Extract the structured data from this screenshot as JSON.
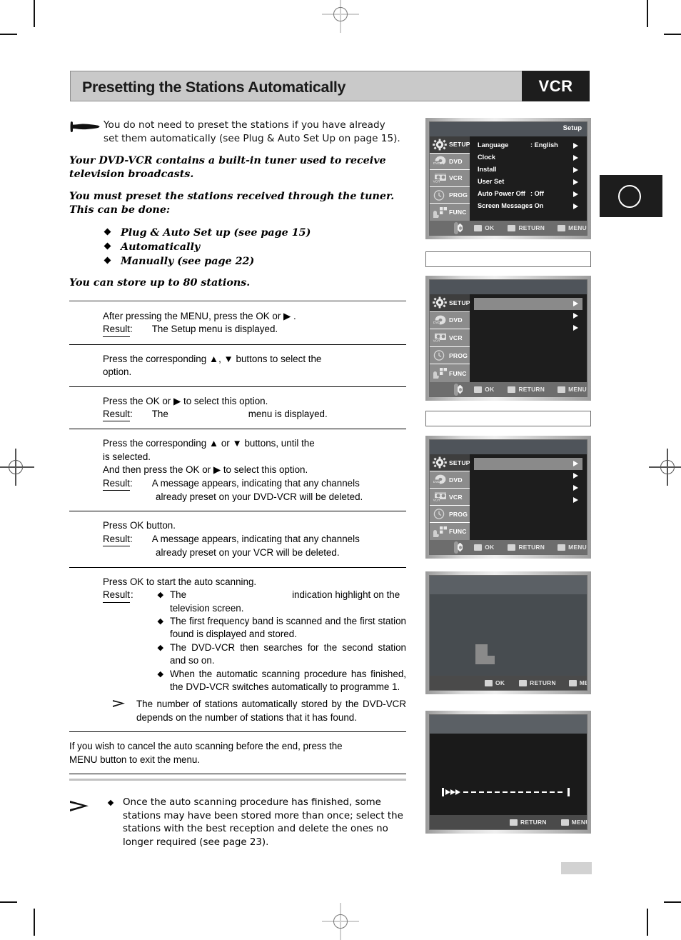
{
  "header": {
    "title": "Presetting the Stations Automatically",
    "badge": "VCR"
  },
  "intro": {
    "hand_note_line1": "You do not need to preset the stations if you have already",
    "hand_note_line2": "set them automatically (see Plug & Auto Set Up on page 15).",
    "para1": "Your DVD-VCR contains a built-in tuner used to receive television broadcasts.",
    "para2": "You must preset the stations received through the tuner. This can be done:",
    "bullets": [
      "Plug & Auto Set up (see page 15)",
      "Automatically",
      "Manually  (see page 22)"
    ],
    "para3": "You can store up to 80 stations."
  },
  "steps": [
    {
      "line1": "After pressing the MENU, press the OK or ▶ .",
      "result_label": "Result",
      "result_text": "The Setup menu is displayed."
    },
    {
      "line1": "Press the corresponding ▲, ▼ buttons to select the",
      "line2": "option."
    },
    {
      "line1": "Press the OK or ▶ to select this option.",
      "result_label": "Result",
      "result_pre": "The",
      "result_post": "menu is displayed."
    },
    {
      "line1": "Press the corresponding ▲ or ▼ buttons, until the",
      "line2": "is selected.",
      "line3": "And then press the OK or ▶ to select this option.",
      "result_label": "Result",
      "result_text1": "A message appears, indicating that any channels",
      "result_text2": "already preset on your DVD-VCR will be deleted."
    },
    {
      "line1": "Press OK button.",
      "result_label": "Result",
      "result_text1": "A message appears, indicating that any channels",
      "result_text2": "already preset on your VCR will be deleted."
    },
    {
      "line1": "Press OK to start the auto scanning.",
      "result_label": "Result",
      "bullets": [
        {
          "pre": "The",
          "post": "indication highlight on the",
          "line2": "television screen."
        },
        {
          "text": "The first frequency band is scanned and the first station found is displayed and stored."
        },
        {
          "text": "The DVD-VCR then searches for the second station and so on."
        },
        {
          "text": "When the automatic scanning procedure has finished, the DVD-VCR switches automatically to programme  1."
        }
      ],
      "note": "The number of stations automatically stored by the DVD-VCR depends on the number of stations that it has found."
    },
    {
      "line1": "If you wish to cancel the auto scanning before the end, press the",
      "line2": "MENU button to exit the menu."
    }
  ],
  "final_note": {
    "text": "Once the auto scanning procedure has finished, some stations may have been stored more than once; select the stations with the best reception and delete the ones no longer required (see page 23)."
  },
  "osd_common": {
    "sidebar": [
      {
        "label": "SETUP",
        "icon": "gear-icon"
      },
      {
        "label": "DVD",
        "icon": "dvd-disc-icon"
      },
      {
        "label": "VCR",
        "icon": "vcr-cassette-icon"
      },
      {
        "label": "PROG",
        "icon": "clock-icon"
      },
      {
        "label": "FUNC",
        "icon": "hand-buttons-icon"
      }
    ],
    "footer": {
      "ok": "OK",
      "return": "RETURN",
      "menu": "MENU"
    }
  },
  "screens": [
    {
      "name": "setup-menu",
      "title": "Setup",
      "rows": [
        {
          "label": "Language",
          "value": ": English",
          "arrow": true
        },
        {
          "label": "Clock",
          "value": "",
          "arrow": true
        },
        {
          "label": "Install",
          "value": "",
          "arrow": true
        },
        {
          "label": "User Set",
          "value": "",
          "arrow": true
        },
        {
          "label": "Auto Power Off",
          "value": ": Off",
          "arrow": true
        },
        {
          "label": "Screen Messages",
          "value": ": On",
          "arrow": true
        }
      ]
    },
    {
      "name": "install-menu-blank",
      "title": "",
      "rows": [
        {
          "label": "",
          "value": "",
          "arrow": true,
          "highlight": true
        },
        {
          "label": "",
          "value": "",
          "arrow": true
        },
        {
          "label": "",
          "value": "",
          "arrow": true
        }
      ]
    },
    {
      "name": "auto-setup-menu-blank",
      "title": "",
      "rows": [
        {
          "label": "",
          "value": "",
          "arrow": true,
          "highlight": true
        },
        {
          "label": "",
          "value": "",
          "arrow": true
        },
        {
          "label": "",
          "value": "",
          "arrow": true
        },
        {
          "label": "",
          "value": "",
          "arrow": true
        }
      ]
    },
    {
      "name": "confirm-message-screen",
      "title": "",
      "footer_only": true
    },
    {
      "name": "auto-scanning-progress-screen",
      "title": "",
      "progress_only": true
    }
  ],
  "captions": [
    {
      "text": ""
    },
    {
      "text": ""
    }
  ],
  "page_number": ""
}
